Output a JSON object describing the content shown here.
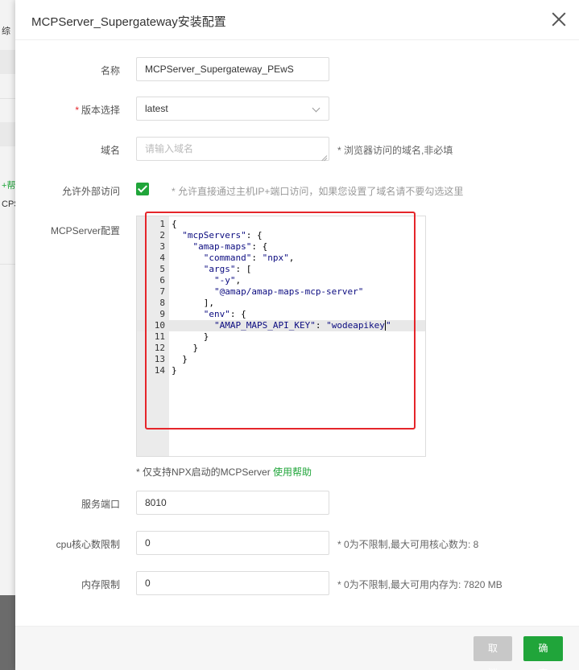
{
  "background": {
    "fragments": [
      "综",
      "+帮",
      "CPS"
    ]
  },
  "modal": {
    "title": "MCPServer_Supergateway安装配置",
    "fields": {
      "name": {
        "label": "名称",
        "value": "MCPServer_Supergateway_PEwS"
      },
      "version": {
        "required_mark": "*",
        "label": "版本选择",
        "value": "latest"
      },
      "domain": {
        "label": "域名",
        "placeholder": "请输入域名",
        "hint": "* 浏览器访问的域名,非必填"
      },
      "external_access": {
        "label": "允许外部访问",
        "checked": true,
        "hint": "* 允许直接通过主机IP+端口访问，如果您设置了域名请不要勾选这里"
      },
      "config": {
        "label": "MCPServer配置",
        "lines": [
          {
            "n": "1",
            "text": "{"
          },
          {
            "n": "2",
            "text": "  \"mcpServers\": {"
          },
          {
            "n": "3",
            "text": "    \"amap-maps\": {"
          },
          {
            "n": "4",
            "text": "      \"command\": \"npx\","
          },
          {
            "n": "5",
            "text": "      \"args\": ["
          },
          {
            "n": "6",
            "text": "        \"-y\","
          },
          {
            "n": "7",
            "text": "        \"@amap/amap-maps-mcp-server\""
          },
          {
            "n": "8",
            "text": "      ],"
          },
          {
            "n": "9",
            "text": "      \"env\": {"
          },
          {
            "n": "10",
            "text": "        \"AMAP_MAPS_API_KEY\": \"wodeapikey\""
          },
          {
            "n": "11",
            "text": "      }"
          },
          {
            "n": "12",
            "text": "    }"
          },
          {
            "n": "13",
            "text": "  }"
          },
          {
            "n": "14",
            "text": "}"
          }
        ],
        "active_line": "10",
        "note_prefix": "* 仅支持NPX启动的MCPServer",
        "help_link": "使用帮助",
        "highlight_color": "#e5252a"
      },
      "port": {
        "label": "服务端口",
        "value": "8010"
      },
      "cpu": {
        "label": "cpu核心数限制",
        "value": "0",
        "hint": "* 0为不限制,最大可用核心数为: 8"
      },
      "memory": {
        "label": "内存限制",
        "value": "0",
        "hint": "* 0为不限制,最大可用内存为: 7820 MB"
      }
    },
    "buttons": {
      "cancel": "取消",
      "confirm": "确定"
    }
  },
  "colors": {
    "accent": "#20a53a",
    "danger": "#e5252a"
  }
}
